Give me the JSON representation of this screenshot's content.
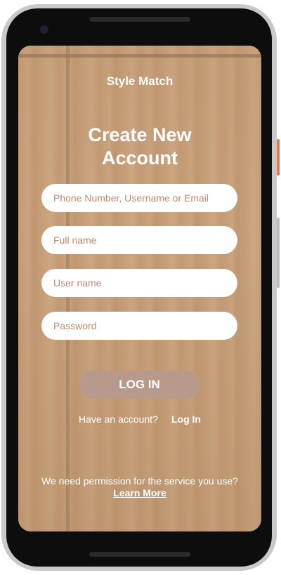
{
  "app": {
    "title": "Style Match"
  },
  "form": {
    "heading_line1": "Create New",
    "heading_line2": "Account",
    "fields": [
      {
        "placeholder": "Phone Number, Username or Email"
      },
      {
        "placeholder": "Full name"
      },
      {
        "placeholder": "User name"
      },
      {
        "placeholder": "Password"
      }
    ],
    "submit_label": "LOG IN"
  },
  "footer": {
    "have_account_text": "Have an account?",
    "login_link": "Log In",
    "permission_text": "We need permission for the service you use?",
    "learn_more_link": "Learn More"
  },
  "colors": {
    "accent": "#b89a8c",
    "placeholder_text": "#c08a6e",
    "background_tone": "#c9a37d"
  }
}
